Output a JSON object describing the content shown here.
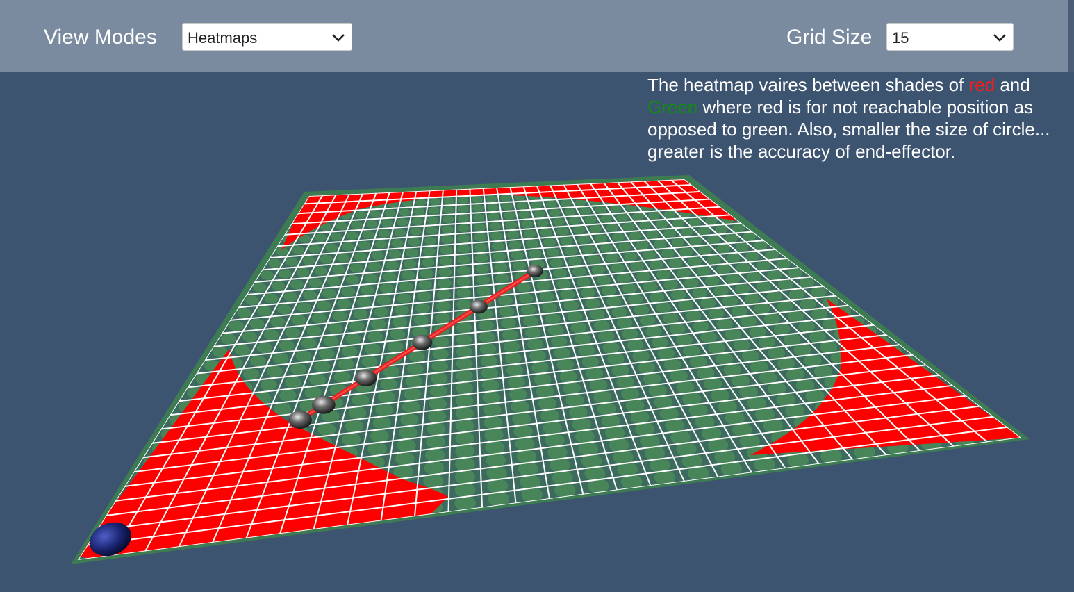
{
  "toolbar": {
    "view_modes_label": "View Modes",
    "view_modes_value": "Heatmaps",
    "grid_size_label": "Grid Size",
    "grid_size_value": "15"
  },
  "info": {
    "part1": "The heatmap vaires between shades of ",
    "red_word": "red",
    "part2": " and ",
    "green_word": "Green",
    "part3": " where red is for not reachable position as opposed to green. Also, smaller the size of circle... greater is the accuracy of end-effector."
  },
  "colors": {
    "background": "#3d5470",
    "toolbar": "#7a8ba0",
    "unreachable": "#ff0000",
    "reachable": "#3e8a4a",
    "grid_lines": "#ffffff",
    "base_sphere": "#1a2470",
    "joint_sphere": "#444444"
  },
  "grid": {
    "size": 15
  }
}
